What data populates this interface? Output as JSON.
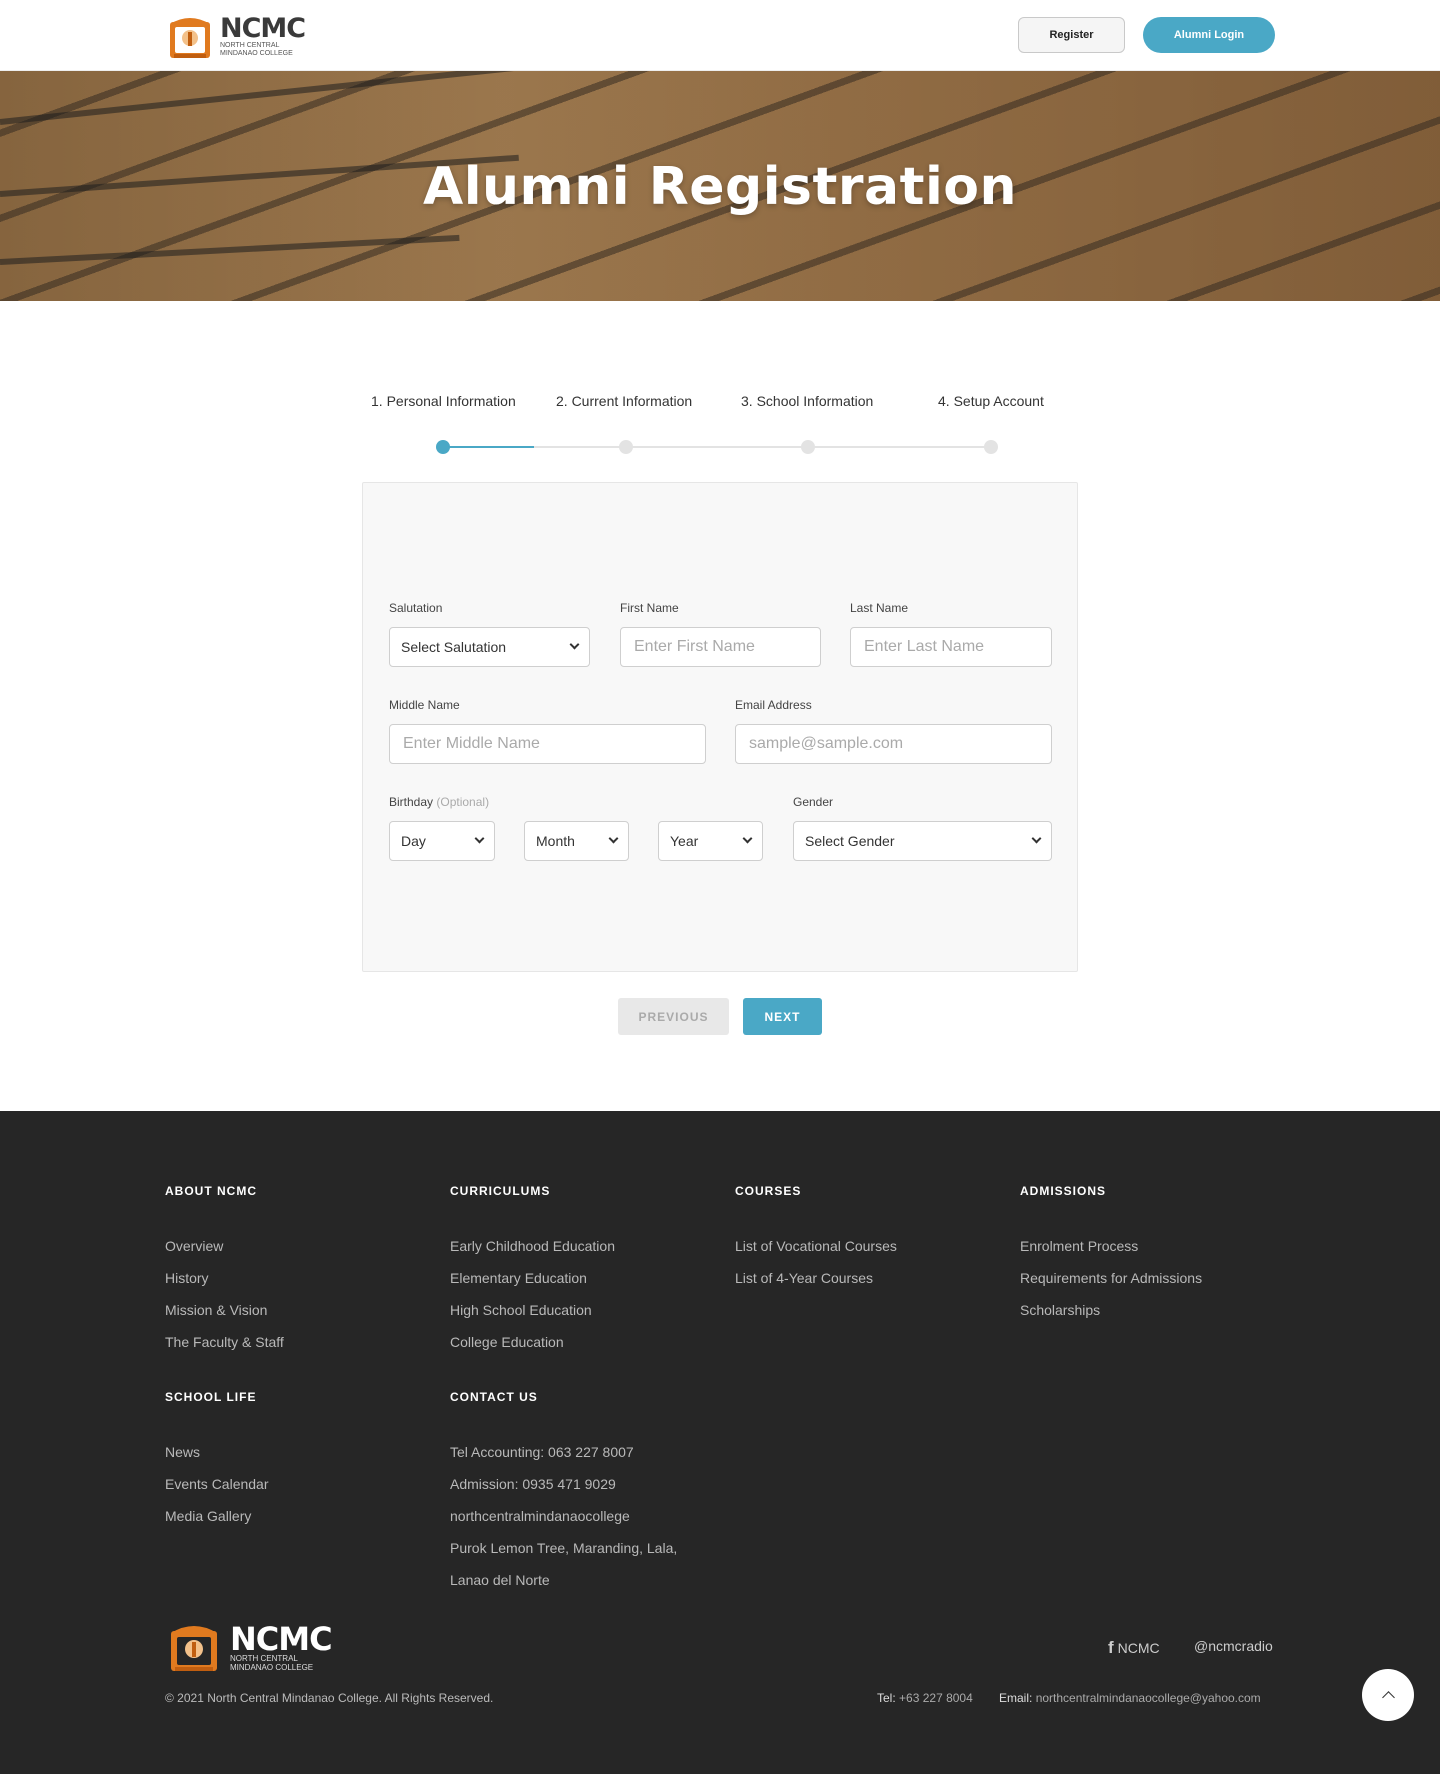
{
  "header": {
    "logo_title": "NCMC",
    "logo_subtitle_1": "North Central",
    "logo_subtitle_2": "Mindanao College",
    "register_label": "Register",
    "login_label": "Alumni Login"
  },
  "hero": {
    "title": "Alumni Registration"
  },
  "steps": {
    "items": [
      {
        "label": "1. Personal Information"
      },
      {
        "label": "2. Current Information"
      },
      {
        "label": "3. School Information"
      },
      {
        "label": "4. Setup Account"
      }
    ],
    "current_step": 1,
    "progress_fraction": 0.5
  },
  "form": {
    "salutation": {
      "label": "Salutation",
      "value": "Select Salutation"
    },
    "first_name": {
      "label": "First Name",
      "placeholder": "Enter First Name"
    },
    "last_name": {
      "label": "Last Name",
      "placeholder": "Enter Last Name"
    },
    "middle_name": {
      "label": "Middle Name",
      "placeholder": "Enter Middle Name"
    },
    "email": {
      "label": "Email Address",
      "placeholder": "sample@sample.com"
    },
    "birthday": {
      "label": "Birthday",
      "optional": "(Optional)",
      "day": "Day",
      "month": "Month",
      "year": "Year"
    },
    "gender": {
      "label": "Gender",
      "value": "Select Gender"
    }
  },
  "nav": {
    "previous_label": "PREVIOUS",
    "next_label": "NEXT"
  },
  "footer": {
    "about": {
      "heading": "About NCMC",
      "links": [
        "Overview",
        "History",
        "Mission & Vision",
        "The Faculty & Staff"
      ]
    },
    "curriculums": {
      "heading": "Curriculums",
      "links": [
        "Early Childhood Education",
        "Elementary Education",
        "High School Education",
        "College Education"
      ]
    },
    "courses": {
      "heading": "Courses",
      "links": [
        "List of Vocational Courses",
        "List of 4-Year Courses"
      ]
    },
    "admissions": {
      "heading": "Admissions",
      "links": [
        "Enrolment Process",
        "Requirements for Admissions",
        "Scholarships"
      ]
    },
    "school_life": {
      "heading": "School Life",
      "links": [
        "News",
        "Events Calendar",
        "Media Gallery"
      ]
    },
    "contact": {
      "heading": "Contact Us",
      "lines": [
        "Tel Accounting: 063 227 8007",
        "Admission: 0935 471 9029",
        "northcentralmindanaocollege",
        "Purok Lemon Tree, Maranding, Lala,",
        "Lanao del Norte"
      ]
    },
    "logo_title": "NCMC",
    "logo_subtitle_1": "North Central",
    "logo_subtitle_2": "Mindanao College",
    "copyright": "© 2021 North Central Mindanao College. All Rights Reserved.",
    "facebook_label": "NCMC",
    "radio_label": "@ncmcradio",
    "tel_label": "Tel:",
    "tel_value": "+63 227 8004",
    "email_label": "Email:",
    "email_value": "northcentralmindanaocollege@yahoo.com"
  },
  "colors": {
    "accent": "#4aa8c6",
    "footer_bg": "#262626",
    "brand_orange": "#e07a1f"
  }
}
